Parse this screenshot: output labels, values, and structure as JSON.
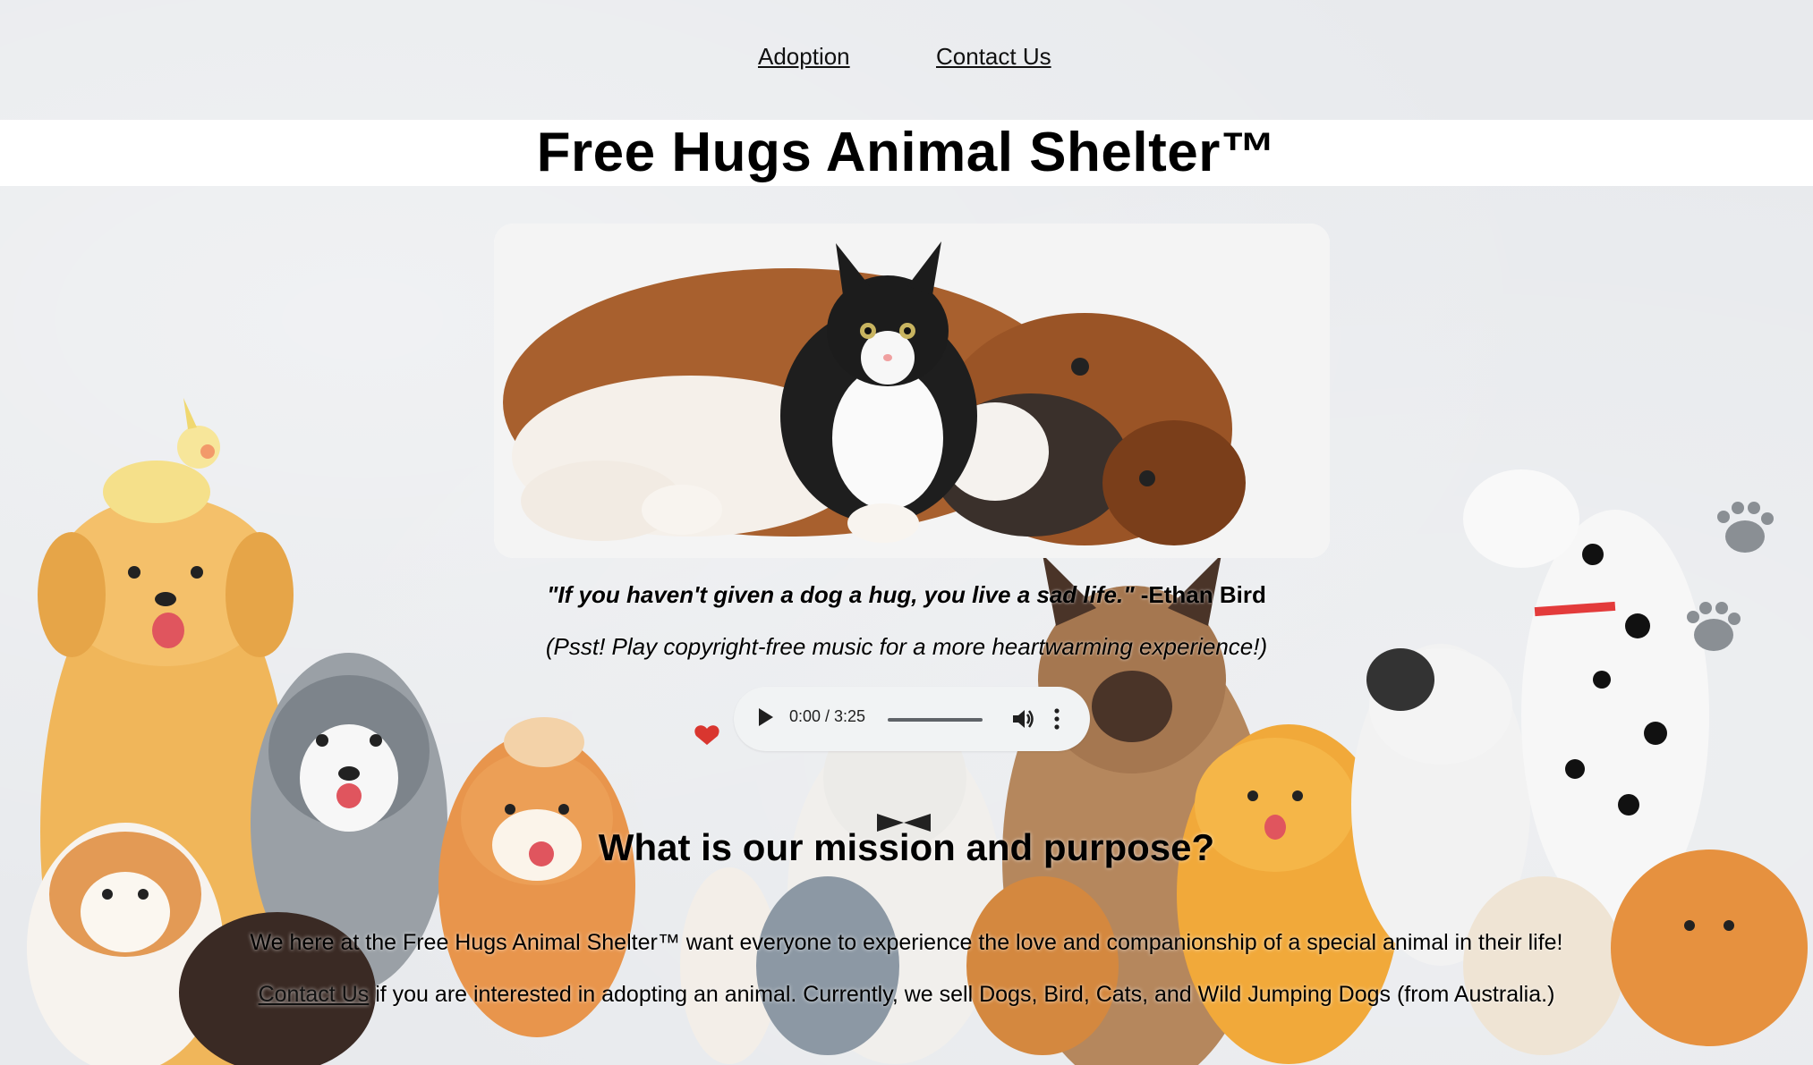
{
  "nav": {
    "adoption_label": "Adoption",
    "contact_label": "Contact Us"
  },
  "header": {
    "title": "Free Hugs Animal Shelter™"
  },
  "quote": {
    "text": "\"If you haven't given a dog a hug, you live a sad life.\"",
    "author": " -Ethan Bird"
  },
  "psst": "(Psst! Play copyright-free music for a more heartwarming experience!)",
  "audio": {
    "time": "0:00 / 3:25",
    "progress_fraction": 0
  },
  "mission": {
    "heading": "What is our mission and purpose?",
    "paragraph1": "We here at the Free Hugs Animal Shelter™ want everyone to experience the love and companionship of a special animal in their life!",
    "contact_link": "Contact Us",
    "paragraph2_rest": " if you are interested in adopting an animal. Currently, we sell Dogs, Bird, Cats, and Wild Jumping Dogs (from Australia.)"
  },
  "icons": {
    "play": "play-icon",
    "volume": "volume-icon",
    "menu": "more-vert-icon",
    "paw": "paw-print-icon"
  },
  "colors": {
    "background": "#e8eaed",
    "title_bar": "#ffffff",
    "player": "#f1f3f4"
  }
}
